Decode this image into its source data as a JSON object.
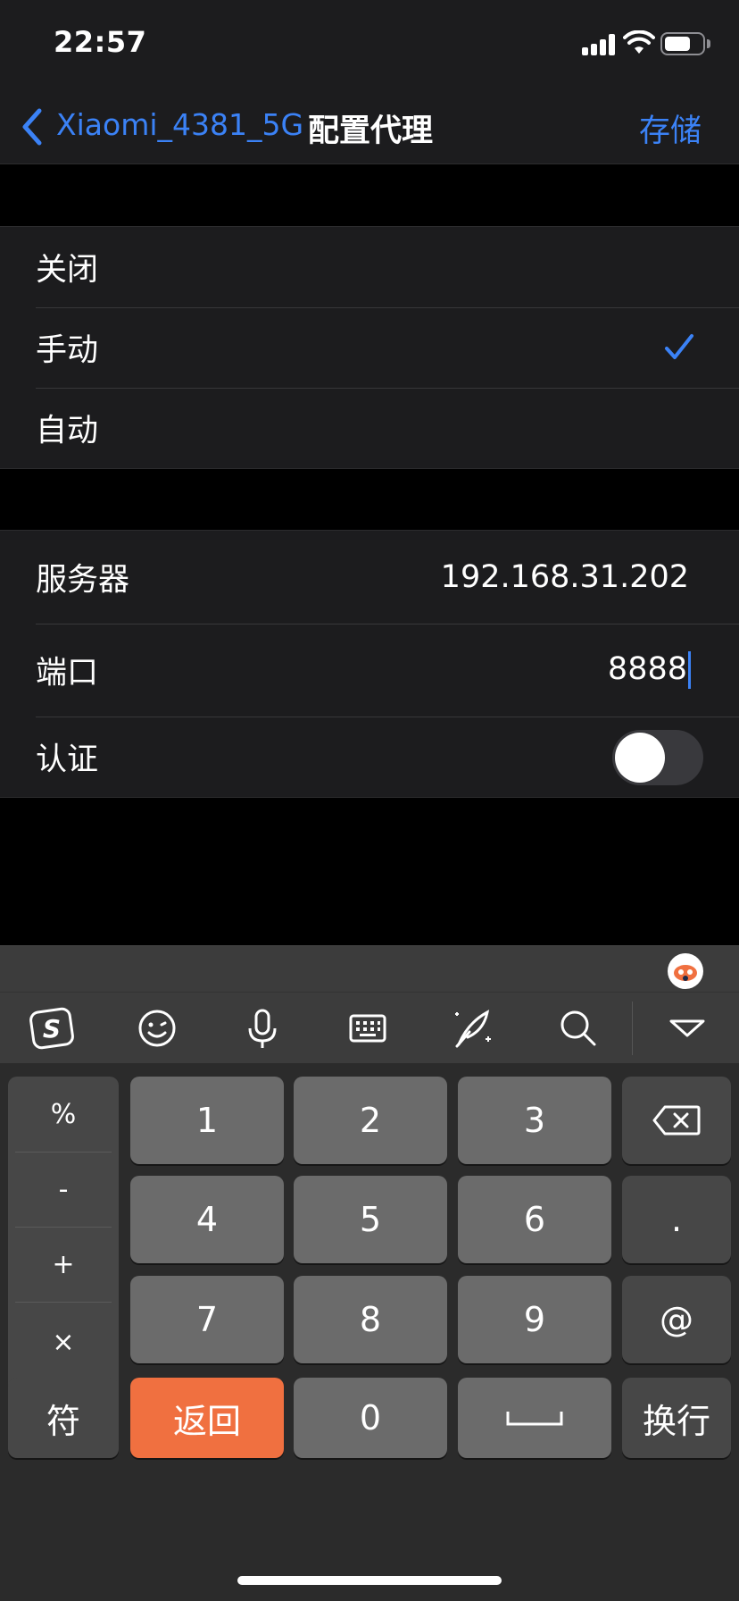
{
  "status_bar": {
    "time": "22:57"
  },
  "nav": {
    "back_label": "Xiaomi_4381_5G",
    "title": "配置代理",
    "save_label": "存储"
  },
  "proxy_modes": {
    "items": [
      {
        "label": "关闭",
        "selected": false
      },
      {
        "label": "手动",
        "selected": true
      },
      {
        "label": "自动",
        "selected": false
      }
    ]
  },
  "settings": {
    "server_label": "服务器",
    "server_value": "192.168.31.202",
    "port_label": "端口",
    "port_value": "8888",
    "auth_label": "认证",
    "auth_enabled": false
  },
  "keyboard": {
    "toolbar_icons": [
      "sogou-logo-icon",
      "emoji-icon",
      "microphone-icon",
      "keyboard-icon",
      "handwriting-icon",
      "search-icon",
      "collapse-icon"
    ],
    "symbols": [
      "%",
      "-",
      "+",
      "×"
    ],
    "digits": [
      "1",
      "2",
      "3",
      "4",
      "5",
      "6",
      "7",
      "8",
      "9",
      "0"
    ],
    "dot": ".",
    "at": "@",
    "fu": "符",
    "back": "返回",
    "enter": "换行"
  },
  "colors": {
    "accent": "#3b82f6",
    "return_key": "#f07040",
    "background": "#000000",
    "cell": "#1c1c1e"
  }
}
